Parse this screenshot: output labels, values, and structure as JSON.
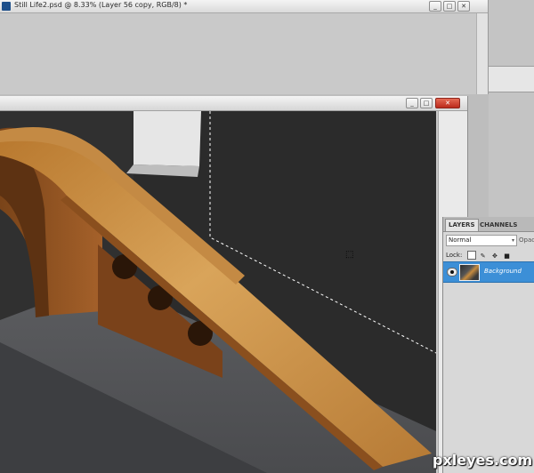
{
  "back_window": {
    "title": "Still Life2.psd @ 8.33% (Layer 56 copy, RGB/8) *",
    "buttons": [
      "_",
      "□",
      "✕"
    ]
  },
  "front_window": {
    "buttons": [
      "_",
      "□",
      "✕"
    ]
  },
  "layers_panel": {
    "tabs": [
      "LAYERS",
      "CHANNELS"
    ],
    "active_tab": "LAYERS",
    "blend_mode": "Normal",
    "opacity_label": "Opaci",
    "lock_label": "Lock:",
    "layers": [
      {
        "name": "Background",
        "selected": true,
        "visible": true
      }
    ]
  },
  "watermark": "pxleyes.com",
  "colors": {
    "selected_layer": "#3c8fd7",
    "close_button": "#c8372a",
    "canvas_wall": "#2f2f2f",
    "wood": "#c68b3e"
  },
  "icons": [
    "photoshop-icon",
    "eye-icon",
    "lock-transparent-icon",
    "lock-brush-icon",
    "lock-move-icon",
    "lock-all-icon",
    "move-cursor-icon"
  ]
}
